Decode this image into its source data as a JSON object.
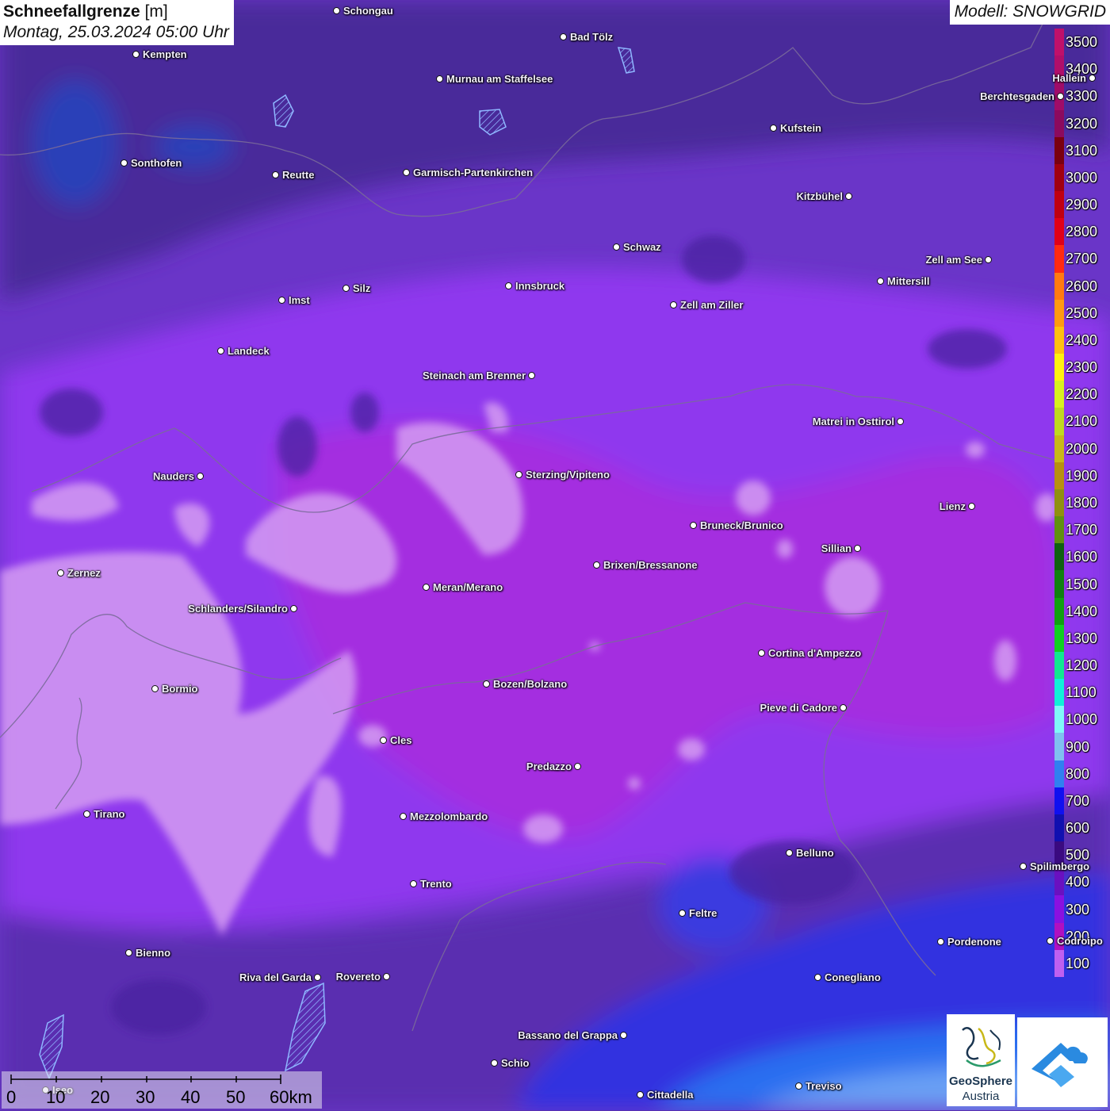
{
  "title": {
    "main": "Schneefallgrenze",
    "unit": "[m]",
    "datetime": "Montag, 25.03.2024 05:00 Uhr"
  },
  "model": "Modell: SNOWGRID",
  "legend": [
    {
      "value": "3500",
      "color": "#c0106a"
    },
    {
      "value": "3400",
      "color": "#b00e6a"
    },
    {
      "value": "3300",
      "color": "#a00c68"
    },
    {
      "value": "3200",
      "color": "#8c0a5e"
    },
    {
      "value": "3100",
      "color": "#7a0010"
    },
    {
      "value": "3000",
      "color": "#a00010"
    },
    {
      "value": "2900",
      "color": "#c00010"
    },
    {
      "value": "2800",
      "color": "#e00018"
    },
    {
      "value": "2700",
      "color": "#ff2a10"
    },
    {
      "value": "2600",
      "color": "#ff7a10"
    },
    {
      "value": "2500",
      "color": "#ff9a10"
    },
    {
      "value": "2400",
      "color": "#ffc010"
    },
    {
      "value": "2300",
      "color": "#fff010"
    },
    {
      "value": "2200",
      "color": "#d8f020"
    },
    {
      "value": "2100",
      "color": "#c0d820"
    },
    {
      "value": "2000",
      "color": "#c8b818"
    },
    {
      "value": "1900",
      "color": "#b89010"
    },
    {
      "value": "1800",
      "color": "#909010"
    },
    {
      "value": "1700",
      "color": "#609010"
    },
    {
      "value": "1600",
      "color": "#106010"
    },
    {
      "value": "1500",
      "color": "#108010"
    },
    {
      "value": "1400",
      "color": "#10a010"
    },
    {
      "value": "1300",
      "color": "#10d020"
    },
    {
      "value": "1200",
      "color": "#10e890"
    },
    {
      "value": "1100",
      "color": "#10f0d8"
    },
    {
      "value": "1000",
      "color": "#80f8f8"
    },
    {
      "value": "900",
      "color": "#80c0f0"
    },
    {
      "value": "800",
      "color": "#3080f0"
    },
    {
      "value": "700",
      "color": "#1010f0"
    },
    {
      "value": "600",
      "color": "#1010b0"
    },
    {
      "value": "500",
      "color": "#3a0a80"
    },
    {
      "value": "400",
      "color": "#6a10c0"
    },
    {
      "value": "300",
      "color": "#8a10e0"
    },
    {
      "value": "200",
      "color": "#b010c0"
    },
    {
      "value": "100",
      "color": "#c060f0"
    }
  ],
  "cities": [
    {
      "name": "Schongau",
      "side": "right"
    },
    {
      "name": "Bad Tölz",
      "side": "right"
    },
    {
      "name": "Kempten",
      "side": "right"
    },
    {
      "name": "Murnau am Staffelsee",
      "side": "right"
    },
    {
      "name": "Hallein",
      "side": "left"
    },
    {
      "name": "Berchtesgaden",
      "side": "left"
    },
    {
      "name": "Kufstein",
      "side": "right"
    },
    {
      "name": "Sonthofen",
      "side": "right"
    },
    {
      "name": "Reutte",
      "side": "right"
    },
    {
      "name": "Garmisch-Partenkirchen",
      "side": "right"
    },
    {
      "name": "Kitzbühel",
      "side": "left"
    },
    {
      "name": "Schwaz",
      "side": "right"
    },
    {
      "name": "Zell am See",
      "side": "left"
    },
    {
      "name": "Innsbruck",
      "side": "right"
    },
    {
      "name": "Mittersill",
      "side": "right"
    },
    {
      "name": "Silz",
      "side": "right"
    },
    {
      "name": "Imst",
      "side": "right"
    },
    {
      "name": "Zell am Ziller",
      "side": "right"
    },
    {
      "name": "Landeck",
      "side": "right"
    },
    {
      "name": "Steinach am Brenner",
      "side": "left"
    },
    {
      "name": "Matrei in Osttirol",
      "side": "left"
    },
    {
      "name": "Nauders",
      "side": "left"
    },
    {
      "name": "Sterzing/Vipiteno",
      "side": "right"
    },
    {
      "name": "Lienz",
      "side": "left"
    },
    {
      "name": "Bruneck/Brunico",
      "side": "right"
    },
    {
      "name": "Sillian",
      "side": "left"
    },
    {
      "name": "Zernez",
      "side": "right"
    },
    {
      "name": "Brixen/Bressanone",
      "side": "right"
    },
    {
      "name": "Meran/Merano",
      "side": "right"
    },
    {
      "name": "Schlanders/Silandro",
      "side": "left"
    },
    {
      "name": "Cortina d'Ampezzo",
      "side": "right"
    },
    {
      "name": "Bozen/Bolzano",
      "side": "right"
    },
    {
      "name": "Bormio",
      "side": "right"
    },
    {
      "name": "Pieve di Cadore",
      "side": "left"
    },
    {
      "name": "Cles",
      "side": "right"
    },
    {
      "name": "Predazzo",
      "side": "left"
    },
    {
      "name": "Tirano",
      "side": "right"
    },
    {
      "name": "Mezzolombardo",
      "side": "right"
    },
    {
      "name": "Belluno",
      "side": "right"
    },
    {
      "name": "Spilimbergo",
      "side": "right"
    },
    {
      "name": "Trento",
      "side": "right"
    },
    {
      "name": "Feltre",
      "side": "right"
    },
    {
      "name": "Pordenone",
      "side": "right"
    },
    {
      "name": "Codroipo",
      "side": "right"
    },
    {
      "name": "Bienno",
      "side": "right"
    },
    {
      "name": "Riva del Garda",
      "side": "left"
    },
    {
      "name": "Rovereto",
      "side": "left"
    },
    {
      "name": "Conegliano",
      "side": "right"
    },
    {
      "name": "Bassano del Grappa",
      "side": "left"
    },
    {
      "name": "Schio",
      "side": "right"
    },
    {
      "name": "Iseo",
      "side": "right"
    },
    {
      "name": "Treviso",
      "side": "right"
    },
    {
      "name": "Cittadella",
      "side": "right"
    }
  ],
  "scale": {
    "labels": [
      "0",
      "10",
      "20",
      "30",
      "40",
      "50",
      "60km"
    ]
  },
  "logos": {
    "geosphere_line1": "GeoSphere",
    "geosphere_line2": "Austria"
  }
}
